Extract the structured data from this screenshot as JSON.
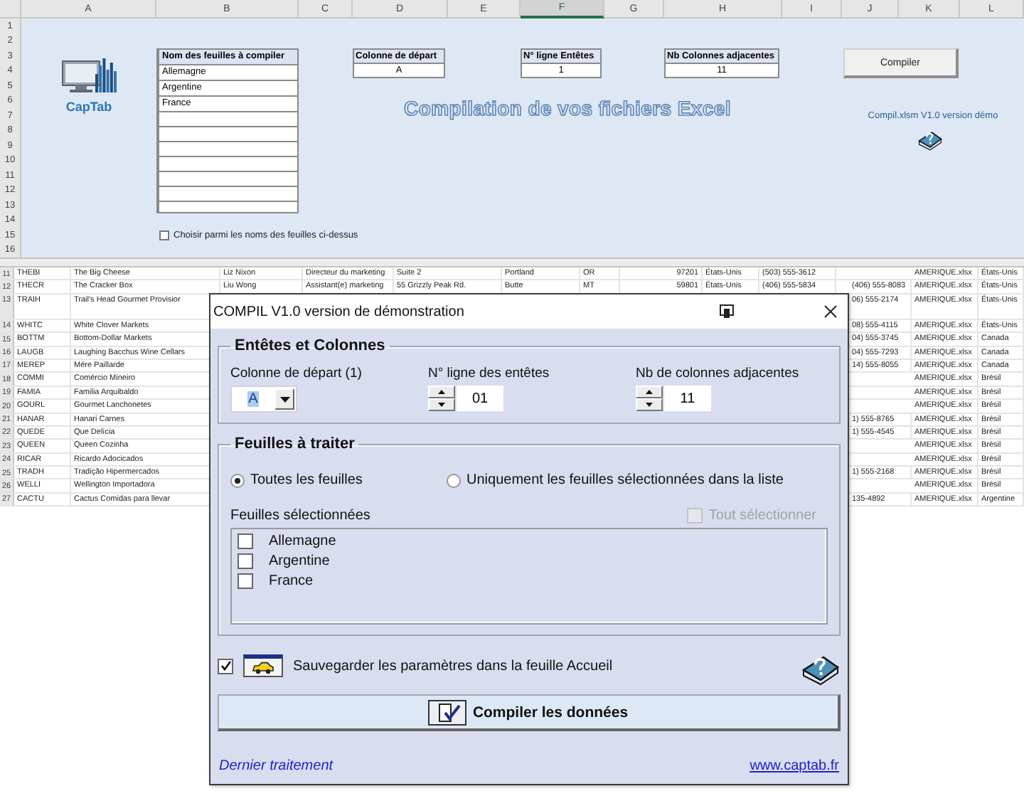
{
  "column_headers": [
    {
      "label": "A",
      "selected": false
    },
    {
      "label": "B",
      "selected": false
    },
    {
      "label": "C",
      "selected": false
    },
    {
      "label": "D",
      "selected": false
    },
    {
      "label": "E",
      "selected": false
    },
    {
      "label": "F",
      "selected": true
    },
    {
      "label": "G",
      "selected": false
    },
    {
      "label": "H",
      "selected": false
    },
    {
      "label": "I",
      "selected": false
    },
    {
      "label": "J",
      "selected": false
    },
    {
      "label": "K",
      "selected": false
    },
    {
      "label": "L",
      "selected": false
    }
  ],
  "top_pane": {
    "row_numbers": [
      "1",
      "2",
      "3",
      "4",
      "5",
      "6",
      "7",
      "8",
      "9",
      "10",
      "11",
      "12",
      "13",
      "14",
      "15",
      "16"
    ],
    "logo": {
      "text": "CapTab"
    },
    "sheet_list": {
      "header": "Nom des feuilles à compiler",
      "items": [
        "Allemagne",
        "Argentine",
        "France"
      ]
    },
    "choose_checkbox": {
      "label": "Choisir parmi les noms des feuilles ci-dessus",
      "checked": false
    },
    "fields": [
      {
        "label": "Colonne de départ",
        "value": "A"
      },
      {
        "label": "N° ligne Entêtes",
        "value": "1"
      },
      {
        "label": "Nb Colonnes adjacentes",
        "value": "11"
      }
    ],
    "compile_button": "Compiler",
    "title": "Compilation de vos fichiers Excel",
    "version": "Compil.xlsm V1.0 version démo"
  },
  "data_rows": [
    {
      "row": "11",
      "tall": false,
      "cells": {
        "A": "THEBI",
        "B": "The Big Cheese",
        "C": "Liz Nixon",
        "D": "Directeur du marketing",
        "E": "Suite 2",
        "F": "Portland",
        "G": "OR",
        "H": "97201",
        "I": "États-Unis",
        "J": "(503) 555-3612",
        "L": "AMERIQUE.xlsx",
        "M": "États-Unis"
      }
    },
    {
      "row": "12",
      "tall": false,
      "cells": {
        "A": "THECR",
        "B": "The Cracker Box",
        "C": "Liu Wong",
        "D": "Assistant(e) marketing",
        "E": "55 Grizzly Peak Rd.",
        "F": "Butte",
        "G": "MT",
        "H": "59801",
        "I": "États-Unis",
        "J": "(406) 555-5834",
        "K": "(406) 555-8083",
        "L": "AMERIQUE.xlsx",
        "M": "États-Unis"
      }
    },
    {
      "row": "13",
      "tall": true,
      "cells": {
        "A": "TRAIH",
        "B": "Trail's Head Gourmet Provisior",
        "K": "06) 555-2174",
        "L": "AMERIQUE.xlsx",
        "M": "États-Unis"
      }
    },
    {
      "row": "14",
      "tall": false,
      "cells": {
        "A": "WHITC",
        "B": "White Clover Markets",
        "K": "08) 555-4115",
        "L": "AMERIQUE.xlsx",
        "M": "États-Unis"
      }
    },
    {
      "row": "15",
      "tall": false,
      "cells": {
        "A": "BOTTM",
        "B": "Bottom-Dollar Markets",
        "K": "04) 555-3745",
        "L": "AMERIQUE.xlsx",
        "M": "Canada"
      }
    },
    {
      "row": "16",
      "tall": false,
      "cells": {
        "A": "LAUGB",
        "B": "Laughing Bacchus Wine Cellars",
        "K": "04) 555-7293",
        "L": "AMERIQUE.xlsx",
        "M": "Canada"
      }
    },
    {
      "row": "17",
      "tall": false,
      "cells": {
        "A": "MEREP",
        "B": "Mère Paillarde",
        "K": "14) 555-8055",
        "L": "AMERIQUE.xlsx",
        "M": "Canada"
      }
    },
    {
      "row": "18",
      "tall": false,
      "cells": {
        "A": "COMMI",
        "B": "Comércio Mineiro",
        "L": "AMERIQUE.xlsx",
        "M": "Brésil"
      }
    },
    {
      "row": "19",
      "tall": false,
      "cells": {
        "A": "FAMIA",
        "B": "Familia Arquibaldo",
        "L": "AMERIQUE.xlsx",
        "M": "Brésil"
      }
    },
    {
      "row": "20",
      "tall": false,
      "cells": {
        "A": "GOURL",
        "B": "Gourmet Lanchonetes",
        "L": "AMERIQUE.xlsx",
        "M": "Brésil"
      }
    },
    {
      "row": "21",
      "tall": false,
      "cells": {
        "A": "HANAR",
        "B": "Hanari Carnes",
        "K": "1) 555-8765",
        "L": "AMERIQUE.xlsx",
        "M": "Brésil"
      }
    },
    {
      "row": "22",
      "tall": false,
      "cells": {
        "A": "QUEDE",
        "B": "Que Delícia",
        "K": "1) 555-4545",
        "L": "AMERIQUE.xlsx",
        "M": "Brésil"
      }
    },
    {
      "row": "23",
      "tall": false,
      "cells": {
        "A": "QUEEN",
        "B": "Queen Cozinha",
        "L": "AMERIQUE.xlsx",
        "M": "Brésil"
      }
    },
    {
      "row": "24",
      "tall": false,
      "cells": {
        "A": "RICAR",
        "B": "Ricardo Adocicados",
        "L": "AMERIQUE.xlsx",
        "M": "Brésil"
      }
    },
    {
      "row": "25",
      "tall": false,
      "cells": {
        "A": "TRADH",
        "B": "Tradição Hipermercados",
        "K": "1) 555-2168",
        "L": "AMERIQUE.xlsx",
        "M": "Brésil"
      }
    },
    {
      "row": "26",
      "tall": false,
      "cells": {
        "A": "WELLI",
        "B": "Wellington Importadora",
        "L": "AMERIQUE.xlsx",
        "M": "Brésil"
      }
    },
    {
      "row": "27",
      "tall": false,
      "cells": {
        "A": "CACTU",
        "B": "Cactus Comidas para llevar",
        "K": "135-4892",
        "L": "AMERIQUE.xlsx",
        "M": "Argentine"
      }
    }
  ],
  "dialog": {
    "title": "COMPIL V1.0 version de démonstration",
    "columns_frame": {
      "legend": "Entêtes et Colonnes",
      "start_column": {
        "label": "Colonne de départ (1)",
        "value": "A"
      },
      "header_row": {
        "label": "N° ligne des entêtes",
        "value": "01"
      },
      "adjacent_columns": {
        "label": "Nb de colonnes adjacentes",
        "value": "11"
      }
    },
    "sheets_frame": {
      "legend": "Feuilles à traiter",
      "options": [
        {
          "label": "Toutes les feuilles",
          "selected": true
        },
        {
          "label": "Uniquement les feuilles sélectionnées dans la liste",
          "selected": false
        }
      ],
      "list_label": "Feuilles sélectionnées",
      "select_all": {
        "label": "Tout sélectionner",
        "checked": false,
        "disabled": true
      },
      "items": [
        {
          "label": "Allemagne",
          "checked": false
        },
        {
          "label": "Argentine",
          "checked": false
        },
        {
          "label": "France",
          "checked": false
        }
      ]
    },
    "save_settings": {
      "label": "Sauvegarder les paramètres dans la feuille Accueil",
      "checked": true
    },
    "compile_button": "Compiler les données",
    "status": "Dernier traitement",
    "link": "www.captab.fr"
  }
}
